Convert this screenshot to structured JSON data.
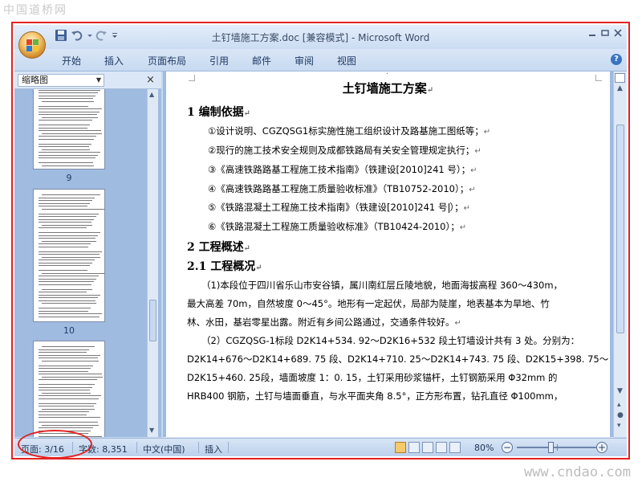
{
  "watermarks": {
    "top": "中国道桥网",
    "bottom": "www.cndao.com"
  },
  "window": {
    "title": "土钉墙施工方案.doc [兼容模式] - Microsoft Word"
  },
  "ribbon": {
    "tabs": [
      "开始",
      "插入",
      "页面布局",
      "引用",
      "邮件",
      "审阅",
      "视图"
    ]
  },
  "thumbnails": {
    "dropdown_label": "缩略图",
    "close": "×",
    "pages": [
      "9",
      "10"
    ]
  },
  "document": {
    "title": "土钉墙施工方案",
    "para_mark": "↵",
    "heading1": "1 编制依据",
    "items": [
      "①设计说明、CGZQSG1标实施性施工组织设计及路基施工图纸等；",
      "②现行的施工技术安全规则及成都铁路局有关安全管理规定执行；",
      "③《高速铁路路基工程施工技术指南》（铁建设[2010]241 号）；",
      "④《高速铁路路基工程施工质量验收标准》（TB10752-2010）；",
      "⑤《铁路混凝土工程施工技术指南》（铁建设[2010]241 号",
      "⑥《铁路混凝土工程施工质量验收标准》（TB10424-2010）；"
    ],
    "item5_tail": "）；",
    "heading2": "2 工程概述",
    "heading21": "2.1 工程概况",
    "para1": [
      "（1)本段位于四川省乐山市安谷镇，属川南红层丘陵地貌，地面海拔高程 360～430m，",
      "最大高差 70m，自然坡度 0～45°。地形有一定起伏，局部为陡崖，地表基本为旱地、竹",
      "林、水田，基岩零星出露。附近有乡间公路通过，交通条件较好。"
    ],
    "para2": [
      "（2）CGZQSG-1标段 D2K14+534. 92～D2K16+532 段土钉墙设计共有 3 处。分别为：",
      "D2K14+676～D2K14+689. 75 段、D2K14+710. 25～D2K14+743. 75 段、D2K15+398. 75～",
      "D2K15+460. 25段，墙面坡度 1：0. 15，土钉采用砂浆锚杆，土钉钢筋采用 Φ32mm 的",
      "HRB400 钢筋，土钉与墙面垂直，与水平面夹角 8.5°，正方形布置，钻孔直径 Φ100mm，"
    ]
  },
  "status": {
    "page": "页面: 3/16",
    "words": "字数: 8,351",
    "language": "中文(中国)",
    "insert_mode": "插入",
    "zoom": "80%",
    "zoom_minus": "−",
    "zoom_plus": "+",
    "zoom_level_fraction": 0.42
  }
}
